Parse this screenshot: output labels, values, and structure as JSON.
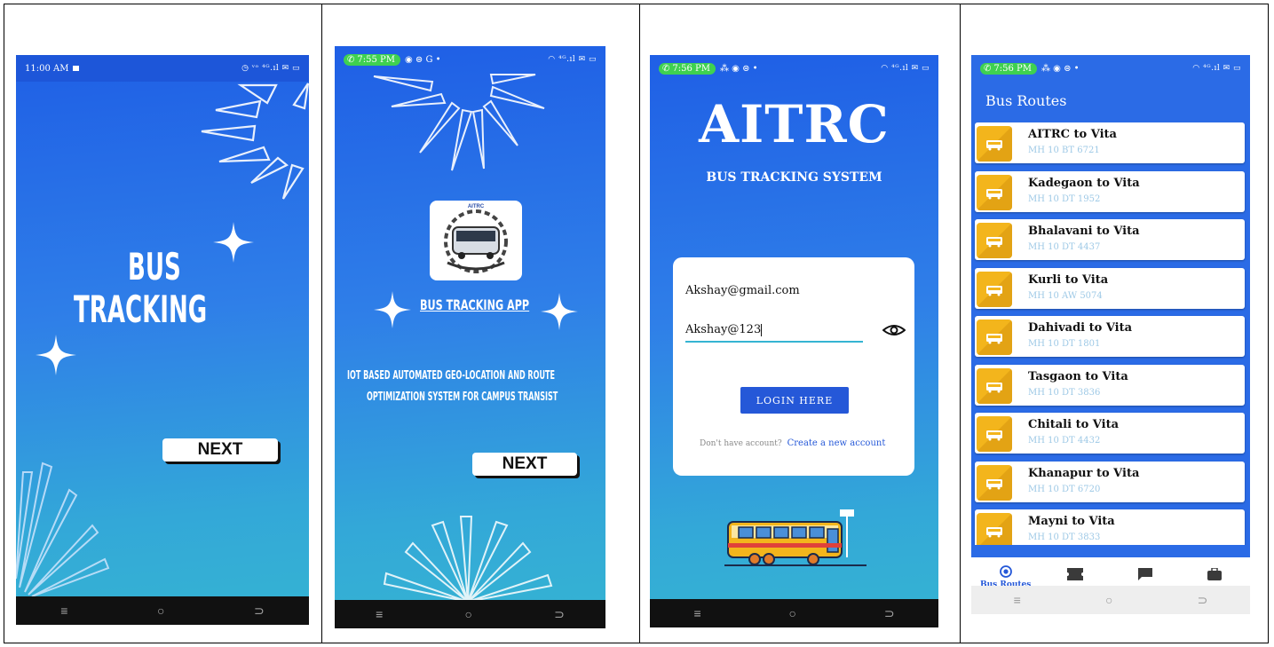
{
  "colors": {
    "accent": "#2558d8",
    "gradient_top": "#1f5fe6",
    "gradient_bottom": "#35b4d2",
    "route_icon": "#f3b51c",
    "call_pill": "#3fd150"
  },
  "phone1": {
    "status_time": "11:00 AM",
    "title_line1": "BUS",
    "title_line2": "TRACKING",
    "next_label": "NEXT",
    "nav": [
      "≡",
      "○",
      "⊃"
    ]
  },
  "phone2": {
    "status_time": "7:55 PM",
    "logo_text": "AITRC",
    "app_title": "BUS TRACKING APP",
    "desc_line1": "IOT BASED AUTOMATED GEO-LOCATION AND ROUTE",
    "desc_line2": "OPTIMIZATION SYSTEM FOR CAMPUS TRANSIST",
    "next_label": "NEXT",
    "nav": [
      "≡",
      "○",
      "⊃"
    ]
  },
  "phone3": {
    "status_time": "7:56 PM",
    "title": "AITRC",
    "subtitle": "BUS TRACKING SYSTEM",
    "email_value": "Akshay@gmail.com",
    "password_value": "Akshay@123",
    "login_label": "LOGIN HERE",
    "no_account_text": "Don't have account?",
    "create_account_link": "Create a new account",
    "nav": [
      "≡",
      "○",
      "⊃"
    ]
  },
  "phone4": {
    "status_time": "7:56 PM",
    "header_title": "Bus Routes",
    "routes": [
      {
        "name": "AITRC to Vita",
        "plate": "MH 10 BT 6721"
      },
      {
        "name": "Kadegaon to Vita",
        "plate": "MH 10 DT 1952"
      },
      {
        "name": "Bhalavani to Vita",
        "plate": "MH 10 DT 4437"
      },
      {
        "name": "Kurli to Vita",
        "plate": "MH 10 AW 5074"
      },
      {
        "name": "Dahivadi to Vita",
        "plate": "MH 10 DT 1801"
      },
      {
        "name": "Tasgaon to Vita",
        "plate": "MH 10 DT 3836"
      },
      {
        "name": "Chitali to Vita",
        "plate": "MH 10 DT 4432"
      },
      {
        "name": "Khanapur to Vita",
        "plate": "MH 10 DT 6720"
      },
      {
        "name": "Mayni to Vita",
        "plate": "MH 10 DT 3833"
      }
    ],
    "bottom_tab_active": "Bus Routes",
    "nav": [
      "≡",
      "○",
      "⊃"
    ]
  }
}
